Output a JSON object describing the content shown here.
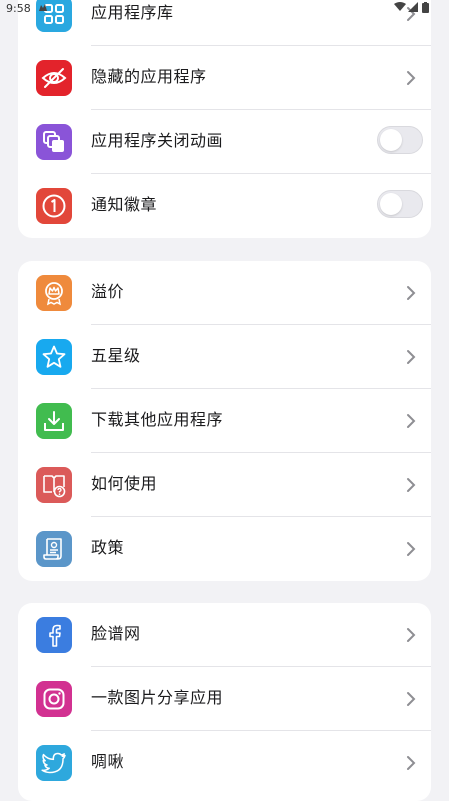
{
  "status_bar": {
    "time": "9:58"
  },
  "card1": {
    "items": [
      {
        "label": "应用程序库",
        "icon": "grid-icon",
        "color": "#2aa8e0",
        "control": "chevron"
      },
      {
        "label": "隐藏的应用程序",
        "icon": "eye-off-icon",
        "color": "#e3232b",
        "control": "chevron"
      },
      {
        "label": "应用程序关闭动画",
        "icon": "stacked-squares-icon",
        "color": "#8a54d8",
        "control": "toggle",
        "toggle_on": false
      },
      {
        "label": "通知徽章",
        "icon": "badge-one-icon",
        "color": "#e2473a",
        "control": "toggle",
        "toggle_on": false
      }
    ]
  },
  "card2": {
    "items": [
      {
        "label": "溢价",
        "icon": "crown-badge-icon",
        "color": "#ef8a3c"
      },
      {
        "label": "五星级",
        "icon": "star-icon",
        "color": "#18a9ef"
      },
      {
        "label": "下载其他应用程序",
        "icon": "download-icon",
        "color": "#41bc4f"
      },
      {
        "label": "如何使用",
        "icon": "book-help-icon",
        "color": "#db5a59"
      },
      {
        "label": "政策",
        "icon": "policy-scroll-icon",
        "color": "#5b96c9"
      }
    ]
  },
  "card3": {
    "items": [
      {
        "label": "脸谱网",
        "icon": "facebook-icon",
        "color": "#3b7de0"
      },
      {
        "label": "一款图片分享应用",
        "icon": "instagram-icon",
        "color": "#d23191"
      },
      {
        "label": "啁啾",
        "icon": "twitter-bird-icon",
        "color": "#2ea8dd"
      }
    ]
  }
}
